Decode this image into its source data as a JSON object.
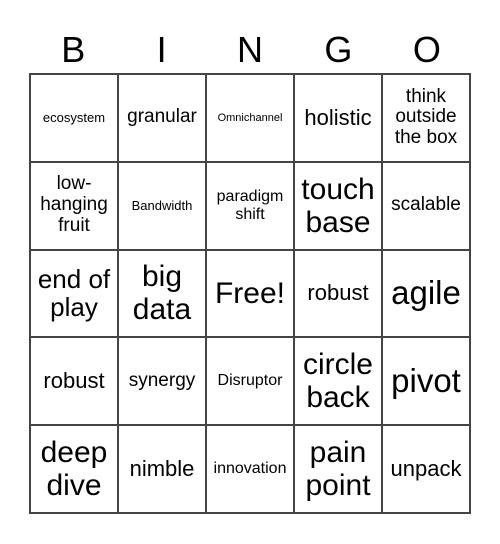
{
  "header": [
    "B",
    "I",
    "N",
    "G",
    "O"
  ],
  "cells": [
    "ecosystem",
    "granular",
    "Omnichannel",
    "holistic",
    "think outside the box",
    "low-hanging fruit",
    "Bandwidth",
    "paradigm shift",
    "touch base",
    "scalable",
    "end of play",
    "big data",
    "Free!",
    "robust",
    "agile",
    "robust",
    "synergy",
    "Disruptor",
    "circle back",
    "pivot",
    "deep dive",
    "nimble",
    "innovation",
    "pain point",
    "unpack"
  ]
}
